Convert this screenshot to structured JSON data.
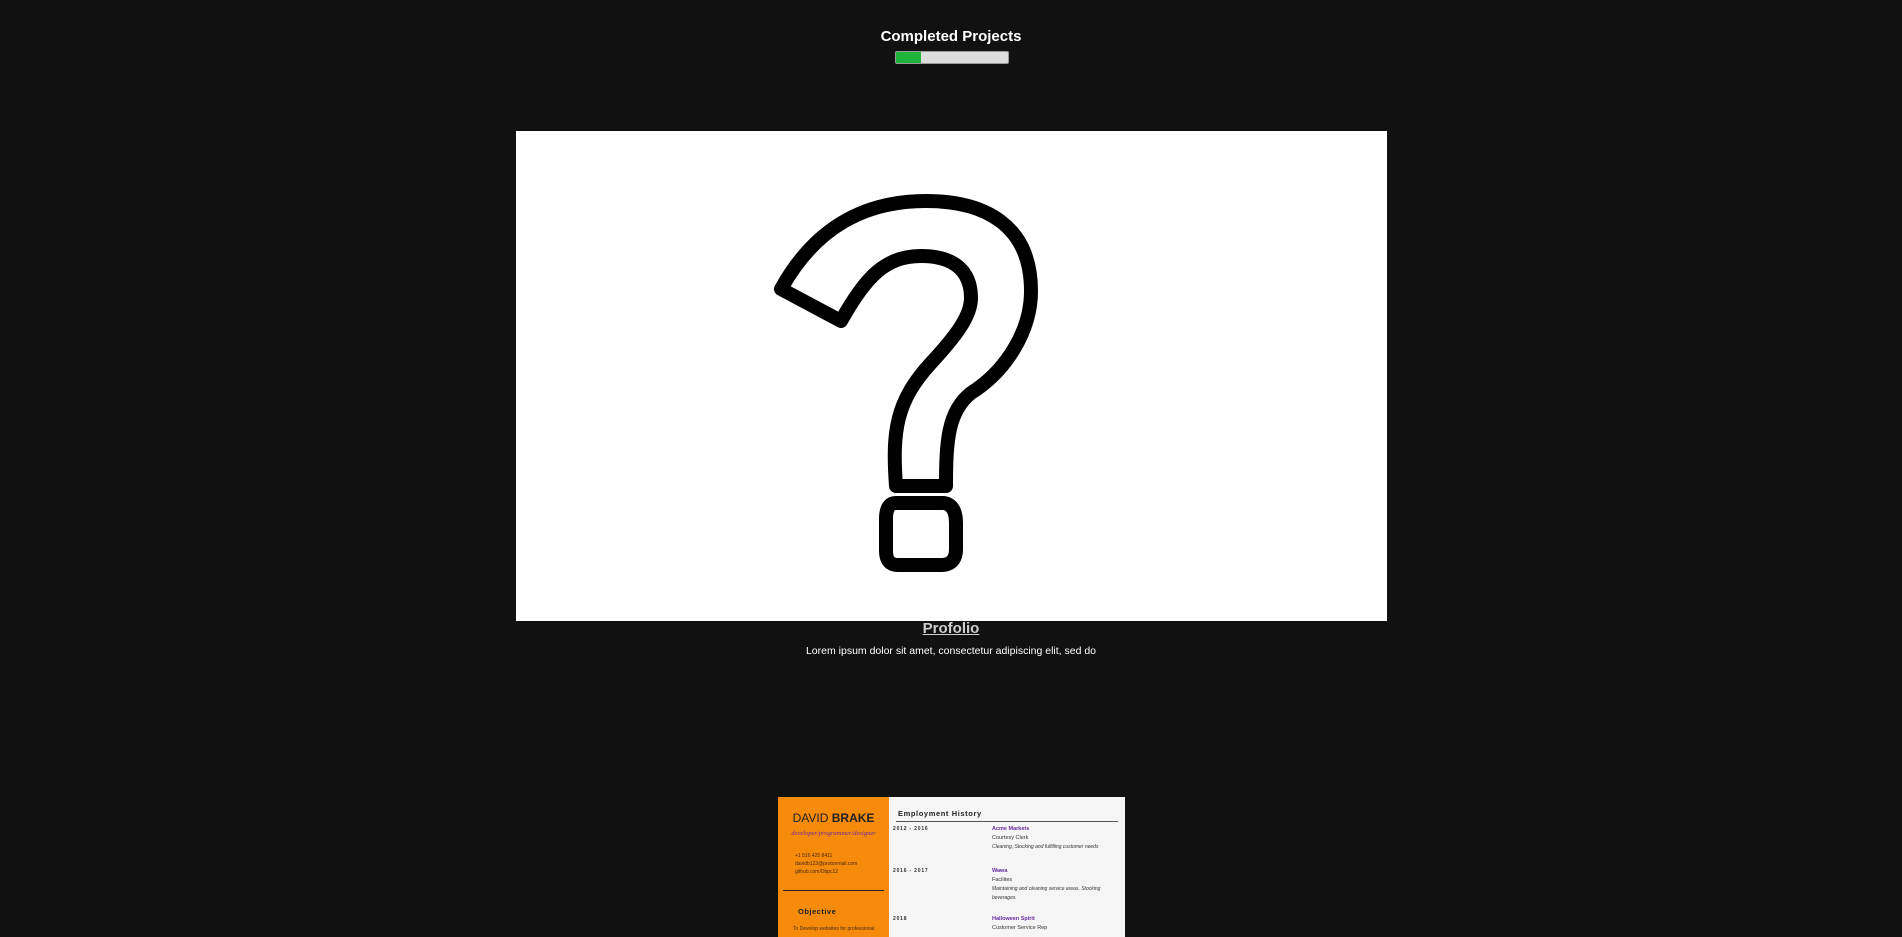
{
  "header": {
    "title": "Completed Projects"
  },
  "progress": {
    "value_fraction": 0.22,
    "fill_color": "#1fb53a"
  },
  "project": {
    "image_icon": "question-mark-icon",
    "title": "Profolio",
    "description": "Lorem ipsum dolor sit amet, consectetur adipiscing elit, sed do"
  },
  "resume_preview": {
    "first_name": "DAVID",
    "last_name": "BRAKE",
    "role": "developer/programmer/designer",
    "phone": "+1 516 425 8411",
    "email": "davidb123@protonmail.com",
    "github": "github.com/Dbpc12",
    "objective_heading": "Objective",
    "objective_text": "To Develop websites for professional",
    "employment_heading": "Employment History",
    "jobs": [
      {
        "dates": "2012 - 2016",
        "company": "Acme Markets",
        "title": "Courtesy Clerk",
        "desc": "Cleaning, Stocking and fulfilling customer needs"
      },
      {
        "dates": "2016 - 2017",
        "company": "Wawa",
        "title": "Facilites",
        "desc": "Maintaining and cleaning service areas. Stocking beverages."
      },
      {
        "dates": "2018",
        "company": "Halloween Spirit",
        "title": "Customer Service Rep",
        "desc": ""
      }
    ],
    "accent_color": "#f58a0b"
  }
}
